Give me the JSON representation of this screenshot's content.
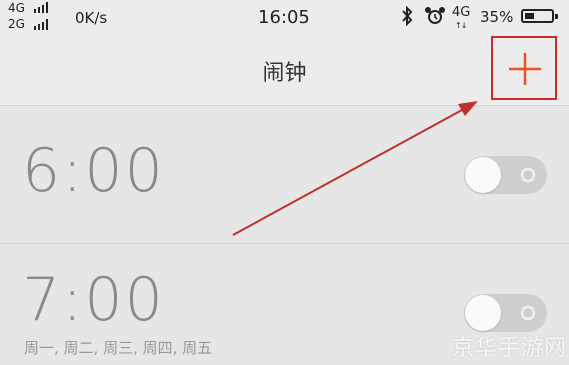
{
  "status_bar": {
    "network1": "4G",
    "network2": "2G",
    "speed": "0K/s",
    "time": "16:05",
    "network3": "4G",
    "data_arrows": "↑↓",
    "battery_pct": "35%",
    "battery_level": 0.35
  },
  "header": {
    "title": "闹钟",
    "add_icon": "plus-icon"
  },
  "alarms": [
    {
      "time": "6:00",
      "enabled": false
    },
    {
      "time": "7:00",
      "days": "周一, 周二, 周三, 周四, 周五",
      "enabled": false
    }
  ],
  "watermark": "京华手游网",
  "colors": {
    "accent": "#e8561e",
    "highlight_box": "#cc2b2b",
    "annotation_arrow": "#c0302c"
  }
}
